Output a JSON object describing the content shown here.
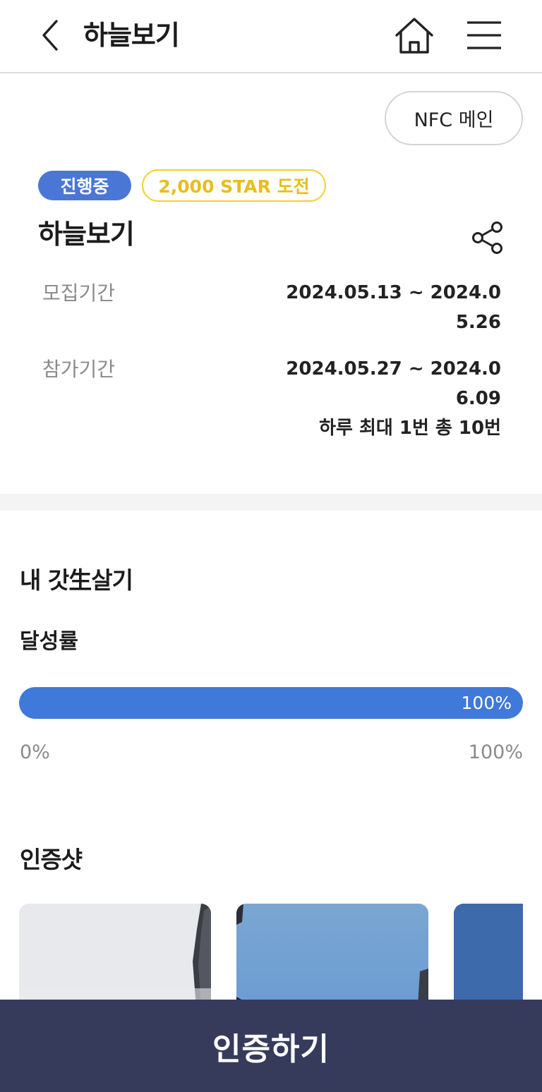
{
  "header": {
    "title": "하늘보기",
    "back_icon": "chevron-left-icon",
    "home_icon": "home-icon",
    "menu_icon": "hamburger-menu-icon"
  },
  "nfc_button": {
    "label": "NFC 메인"
  },
  "badges": {
    "status": "진행중",
    "star": "2,000 STAR 도전",
    "status_color": "#4a76d6",
    "star_color": "#f2cf38"
  },
  "challenge": {
    "title": "하늘보기",
    "share_icon": "share-icon",
    "recruit_label": "모집기간",
    "recruit_value": "2024.05.13 ~ 2024.05.26",
    "participate_label": "참가기간",
    "participate_value": "2024.05.27 ~ 2024.06.09",
    "frequency": "하루 최대 1번 총 10번"
  },
  "my_section": {
    "title": "내 갓生살기",
    "rate_label": "달성률",
    "progress": 1.0,
    "progress_text": "100%",
    "scale_min": "0%",
    "scale_max": "100%",
    "accent": "#3f79d9"
  },
  "shots": {
    "title": "인증샷",
    "items": [
      {
        "name": "cert-photo-1",
        "desc": "sky photo"
      },
      {
        "name": "cert-photo-2",
        "desc": "sky photo"
      },
      {
        "name": "cert-photo-3",
        "desc": "sky photo"
      }
    ]
  },
  "cta": {
    "label": "인증하기",
    "color": "#363b5c"
  }
}
